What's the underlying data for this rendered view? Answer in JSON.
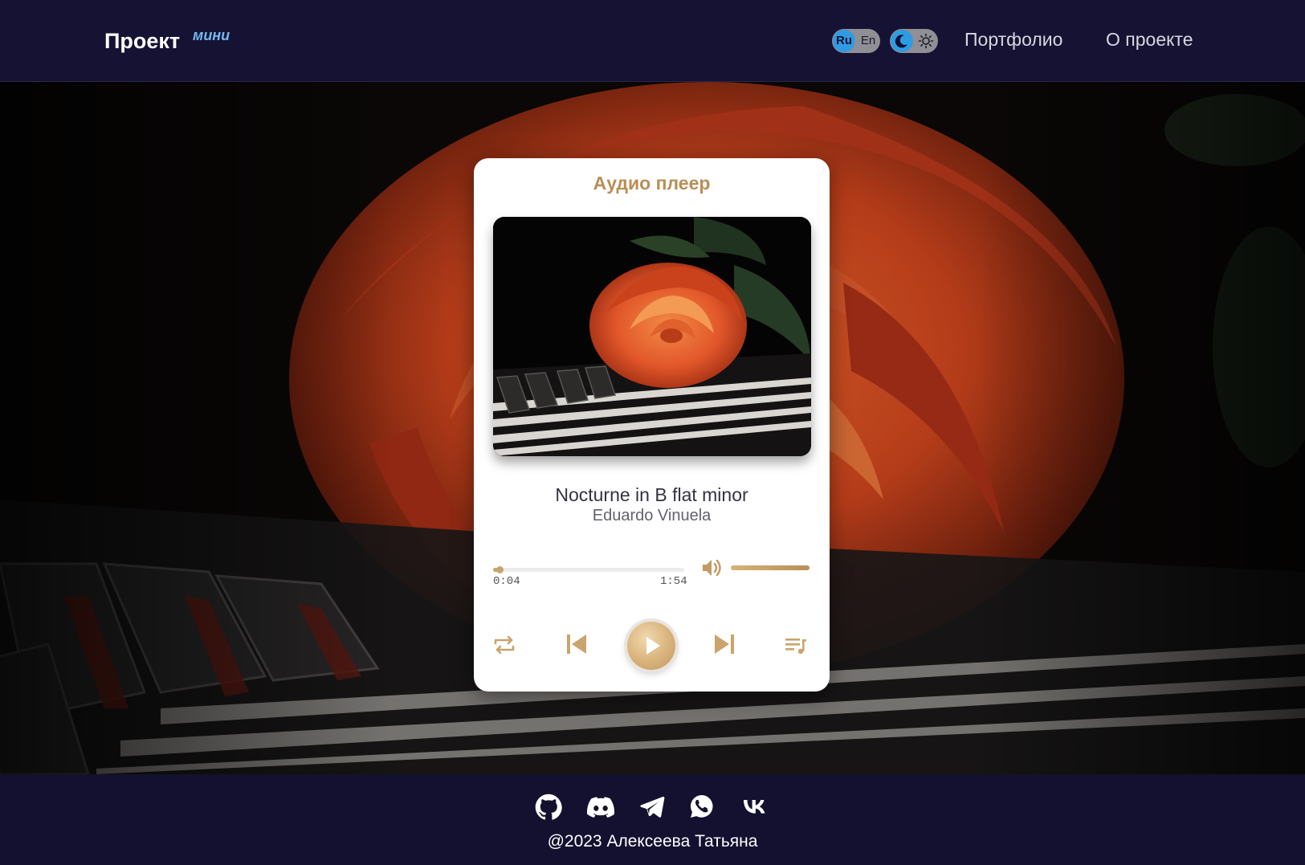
{
  "header": {
    "brand": "Проект",
    "brand_sup": "мини",
    "lang": {
      "ru": "Ru",
      "en": "En",
      "active": "Ru"
    },
    "theme": {
      "active": "dark",
      "icons": [
        "moon-icon",
        "sun-icon"
      ]
    },
    "nav": [
      {
        "label": "Портфолио"
      },
      {
        "label": "О проекте"
      }
    ]
  },
  "player": {
    "title": "Аудио плеер",
    "cover_image": "rose-on-piano-keys",
    "track": {
      "title": "Nocturne in B flat minor",
      "artist": "Eduardo Vinuela"
    },
    "time": {
      "current": "0:04",
      "total": "1:54"
    },
    "progress": 0.035,
    "volume": 1.0,
    "controls": [
      "repeat-icon",
      "previous-icon",
      "play-icon",
      "next-icon",
      "playlist-icon"
    ]
  },
  "footer": {
    "social": [
      "github-icon",
      "discord-icon",
      "telegram-icon",
      "whatsapp-icon",
      "vk-icon"
    ],
    "copyright": "@2023 Алексеева Татьяна"
  },
  "colors": {
    "header_bg": "#161233",
    "accent_gold": "#b98e55",
    "toggle_blue": "#2f9be3",
    "brand_sup": "#74b9f0"
  }
}
